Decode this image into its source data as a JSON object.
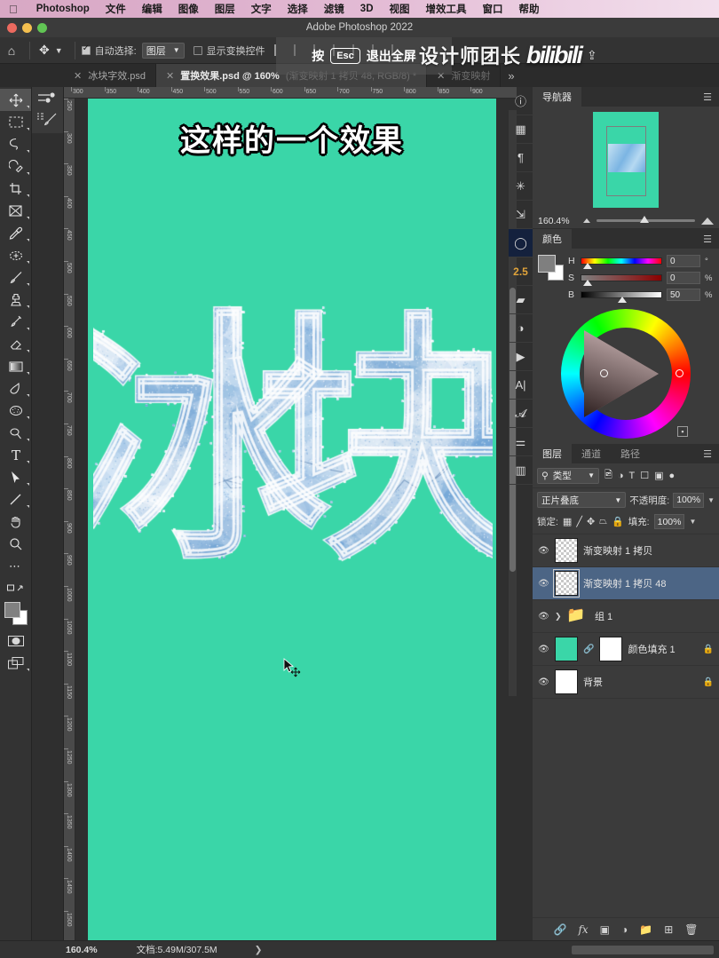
{
  "macbar": {
    "apple_icon": "apple-icon",
    "app_name": "Photoshop",
    "menus": [
      "文件",
      "编辑",
      "图像",
      "图层",
      "文字",
      "选择",
      "滤镜",
      "3D",
      "视图",
      "增效工具",
      "窗口",
      "帮助"
    ]
  },
  "titlebar": {
    "title": "Adobe Photoshop 2022"
  },
  "options_bar": {
    "home_icon": "home-icon",
    "tool_icon": "move-tool-icon",
    "auto_select_label": "自动选择:",
    "auto_select_checked": true,
    "auto_select_value": "图层",
    "show_transform_label": "显示变换控件",
    "show_transform_checked": false
  },
  "esc_overlay": {
    "prefix": "按",
    "key": "Esc",
    "suffix": "退出全屏"
  },
  "watermark": {
    "author": "设计师团长",
    "brand": "bilibili",
    "share_icon": "share-icon"
  },
  "tabs": [
    {
      "label": "冰块字效.psd",
      "suffix": "",
      "active": false
    },
    {
      "label": "置换效果.psd @ 160%",
      "suffix": "(渐变映射 1 拷贝 48, RGB/8) *",
      "active": true
    },
    {
      "label": "渐变映射",
      "suffix": "",
      "active": false
    }
  ],
  "tab_overflow_icon": "chevron-double-right-icon",
  "tools": [
    "move-tool-icon",
    "marquee-tool-icon",
    "lasso-tool-icon",
    "object-select-tool-icon",
    "crop-tool-icon",
    "frame-tool-icon",
    "eyedropper-tool-icon",
    "healing-brush-tool-icon",
    "brush-tool-icon",
    "clone-stamp-tool-icon",
    "history-brush-tool-icon",
    "eraser-tool-icon",
    "gradient-tool-icon",
    "blur-tool-icon",
    "sponge-tool-icon",
    "dodge-tool-icon",
    "type-tool-icon",
    "path-selection-tool-icon",
    "line-tool-icon",
    "hand-tool-icon",
    "zoom-tool-icon",
    "more-tools-icon",
    "edit-toolbar-icon"
  ],
  "rulers": {
    "horizontal": [
      "300",
      "350",
      "400",
      "450",
      "500",
      "550",
      "600",
      "650",
      "700",
      "750",
      "800",
      "850",
      "900"
    ],
    "vertical": [
      "250",
      "300",
      "350",
      "400",
      "450",
      "500",
      "550",
      "600",
      "650",
      "700",
      "750",
      "800",
      "850",
      "900",
      "950",
      "1000",
      "1050",
      "1100",
      "1150",
      "1200",
      "1250",
      "1300",
      "1350",
      "1400",
      "1450",
      "1500"
    ]
  },
  "canvas": {
    "overlay_text": "这样的一个效果",
    "background_color": "#3ad6a8",
    "ice_text": "冰块",
    "cursor_icon": "move-cursor-icon"
  },
  "rail_icons": [
    {
      "name": "info-icon",
      "glyph": "ⓘ",
      "selected": false
    },
    {
      "name": "table-icon",
      "glyph": "▦",
      "selected": false
    },
    {
      "name": "paragraph-icon",
      "glyph": "¶",
      "selected": false
    },
    {
      "name": "sparkle-icon",
      "glyph": "✳",
      "selected": false
    },
    {
      "name": "action-icon",
      "glyph": "⇲",
      "selected": false
    },
    {
      "name": "history-circle-icon",
      "glyph": "◯",
      "selected": true
    },
    {
      "name": "version-number",
      "glyph": "2.5",
      "selected": false
    },
    {
      "name": "layers-3d-icon",
      "glyph": "▰",
      "selected": false
    },
    {
      "name": "adjustments-icon",
      "glyph": "◑",
      "selected": false
    },
    {
      "name": "play-icon",
      "glyph": "▶",
      "selected": false
    },
    {
      "name": "character-icon",
      "glyph": "A|",
      "selected": false
    },
    {
      "name": "glyphs-icon",
      "glyph": "𝓐",
      "selected": false
    },
    {
      "name": "properties-sliders-icon",
      "glyph": "⚌",
      "selected": false
    },
    {
      "name": "histogram-icon",
      "glyph": "▥",
      "selected": false
    }
  ],
  "navigator": {
    "tab_label": "导航器",
    "menu_icon": "panel-menu-icon",
    "zoom_value": "160.4%",
    "zoom_out_icon": "zoom-out-icon",
    "zoom_in_icon": "zoom-in-icon"
  },
  "color_panel": {
    "tab_label": "颜色",
    "menu_icon": "panel-menu-icon",
    "channels": [
      {
        "label": "H",
        "value": "0",
        "unit": "°"
      },
      {
        "label": "S",
        "value": "0",
        "unit": "%"
      },
      {
        "label": "B",
        "value": "50",
        "unit": "%"
      }
    ],
    "foreground": "#7f7f7f",
    "background": "#ffffff",
    "add_swatch_icon": "add-swatch-icon"
  },
  "layers_panel": {
    "tabs": [
      "图层",
      "通道",
      "路径"
    ],
    "active_tab": "图层",
    "menu_icon": "panel-menu-icon",
    "filter": {
      "search_icon": "search-icon",
      "value": "类型",
      "chevron_icon": "chevron-down-icon",
      "icons": [
        "image-filter-icon",
        "adjustment-filter-icon",
        "type-filter-icon",
        "shape-filter-icon",
        "smart-object-filter-icon"
      ],
      "toggle_icon": "filter-toggle-icon"
    },
    "blend_mode": "正片叠底",
    "opacity_label": "不透明度:",
    "opacity_value": "100%",
    "lock_label": "锁定:",
    "lock_icons": [
      "lock-transparent-icon",
      "lock-image-icon",
      "lock-position-icon",
      "lock-artboard-icon",
      "lock-all-icon"
    ],
    "fill_label": "填充:",
    "fill_value": "100%",
    "layers": [
      {
        "name": "渐变映射 1 拷贝",
        "visible": true,
        "selected": false,
        "thumb": "checker",
        "locked": false,
        "group": false
      },
      {
        "name": "渐变映射 1 拷贝 48",
        "visible": true,
        "selected": true,
        "thumb": "checker",
        "locked": false,
        "group": false
      },
      {
        "name": "组 1",
        "visible": true,
        "selected": false,
        "thumb": "folder",
        "locked": false,
        "group": true
      },
      {
        "name": "颜色填充 1",
        "visible": true,
        "selected": false,
        "thumb": "green",
        "locked": true,
        "group": false
      },
      {
        "name": "背景",
        "visible": true,
        "selected": false,
        "thumb": "white",
        "locked": true,
        "group": false
      }
    ],
    "footer_icons": [
      "link-layers-icon",
      "fx-icon",
      "add-mask-icon",
      "adjustment-layer-icon",
      "new-group-icon",
      "new-layer-icon",
      "delete-layer-icon"
    ]
  },
  "status_bar": {
    "zoom": "160.4%",
    "doc_label": "文档:5.49M/307.5M",
    "chevron_icon": "chevron-right-icon"
  }
}
